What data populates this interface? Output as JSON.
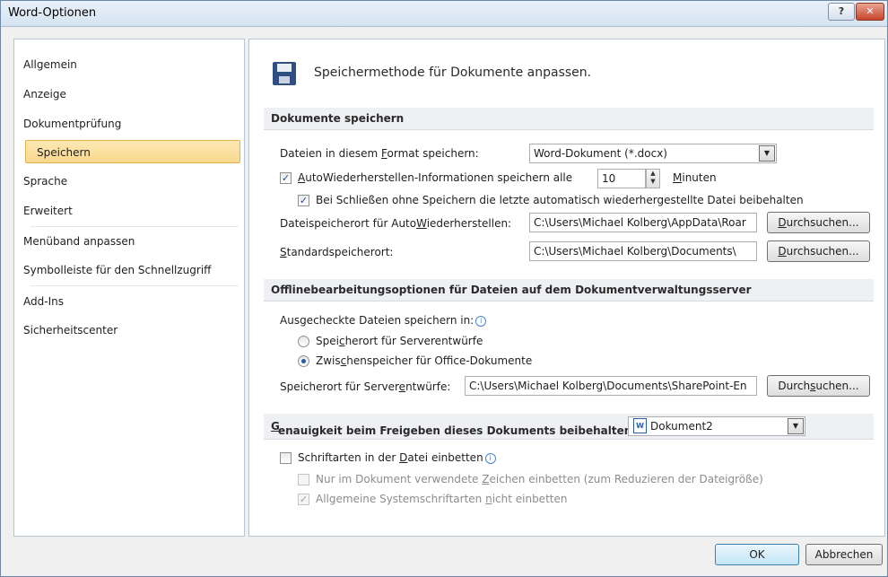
{
  "window": {
    "title": "Word-Optionen",
    "help_glyph": "?",
    "close_glyph": "✕"
  },
  "nav": {
    "items": [
      {
        "label": "Allgemein",
        "selected": false
      },
      {
        "label": "Anzeige",
        "selected": false
      },
      {
        "label": "Dokumentprüfung",
        "selected": false
      },
      {
        "label": "Speichern",
        "selected": true
      },
      {
        "label": "Sprache",
        "selected": false
      },
      {
        "label": "Erweitert",
        "selected": false
      },
      {
        "label": "Menüband anpassen",
        "selected": false
      },
      {
        "label": "Symbolleiste für den Schnellzugriff",
        "selected": false
      },
      {
        "label": "Add-Ins",
        "selected": false
      },
      {
        "label": "Sicherheitscenter",
        "selected": false
      }
    ]
  },
  "main": {
    "heading": "Speichermethode für Dokumente anpassen.",
    "save_section": {
      "title": "Dokumente speichern",
      "format_label_pre": "Dateien in diesem ",
      "format_label_key": "F",
      "format_label_post": "ormat speichern:",
      "format_value": "Word-Dokument (*.docx)",
      "autorecover_checked": true,
      "autorecover_label_key": "A",
      "autorecover_label_post": "utoWiederherstellen-Informationen speichern alle",
      "autorecover_minutes": "10",
      "minutes_key": "M",
      "minutes_post": "inuten",
      "keep_last_checked": true,
      "keep_last_label": "Bei Schließen ohne Speichern die letzte automatisch wiederhergestellte Datei beibehalten",
      "autorecover_location_pre": "Dateispeicherort für Auto",
      "autorecover_location_key": "W",
      "autorecover_location_post": "iederherstellen:",
      "autorecover_location_value": "C:\\Users\\Michael Kolberg\\AppData\\Roar",
      "default_location_pre": "",
      "default_location_key": "S",
      "default_location_post": "tandardspeicherort:",
      "default_location_value": "C:\\Users\\Michael Kolberg\\Documents\\",
      "browse_key": "D",
      "browse_post": "urchsuchen..."
    },
    "offline_section": {
      "title": "Offlinebearbeitungsoptionen für Dateien auf dem Dokumentverwaltungsserver",
      "checked_out_label": "Ausgecheckte Dateien speichern in:",
      "info_glyph": "i",
      "radio_server_pre": "Spei",
      "radio_server_key": "c",
      "radio_server_post": "herort für Serverentwürfe",
      "radio_server_selected": false,
      "radio_cache_pre": "Zwis",
      "radio_cache_key": "c",
      "radio_cache_post": "henspeicher für Office-Dokumente",
      "radio_cache_selected": true,
      "drafts_location_pre": "Speicherort für Server",
      "drafts_location_key": "e",
      "drafts_location_post": "ntwürfe:",
      "drafts_location_value": "C:\\Users\\Michael Kolberg\\Documents\\SharePoint-En",
      "browse_pre": "Durch",
      "browse_key": "s",
      "browse_post": "uchen..."
    },
    "fidelity_section": {
      "title_key": "G",
      "title_post": "enauigkeit beim Freigeben dieses Dokuments beibehalten:",
      "document_value": "Dokument2",
      "embed_fonts_checked": false,
      "embed_fonts_pre": "Schriftarten in der ",
      "embed_fonts_key": "D",
      "embed_fonts_post": "atei einbetten",
      "only_used_checked": false,
      "only_used_pre": "Nur im Dokument verwendete ",
      "only_used_key": "Z",
      "only_used_post": "eichen einbetten (zum Reduzieren der Dateigröße)",
      "no_system_checked": true,
      "no_system_pre": "Allgemeine Systemschriftarten ",
      "no_system_key": "n",
      "no_system_post": "icht einbetten"
    }
  },
  "footer": {
    "ok_label": "OK",
    "cancel_label": "Abbrechen"
  },
  "icons": {
    "check": "✓",
    "dropdown": "▼",
    "spin_up": "▲",
    "spin_down": "▼",
    "word_doc": "W"
  }
}
